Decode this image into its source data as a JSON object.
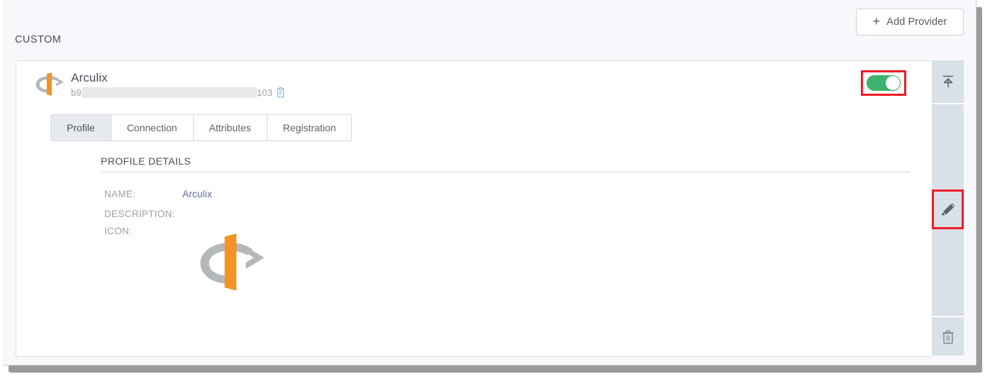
{
  "toolbar": {
    "add_provider_label": "Add Provider",
    "plus_glyph": "+"
  },
  "section": {
    "group_label": "CUSTOM"
  },
  "provider": {
    "name": "Arculix",
    "id_prefix": "b9",
    "id_suffix": "103",
    "id_redacted": true,
    "enabled": true,
    "logo_icon": "arculix-logo-icon",
    "copy_icon": "copy-clipboard-icon"
  },
  "tabs": [
    {
      "label": "Profile",
      "active": true
    },
    {
      "label": "Connection",
      "active": false
    },
    {
      "label": "Attributes",
      "active": false
    },
    {
      "label": "Registration",
      "active": false
    }
  ],
  "profile": {
    "section_title": "PROFILE DETAILS",
    "fields": [
      {
        "label": "NAME:",
        "value": "Arculix"
      },
      {
        "label": "DESCRIPTION:",
        "value": ""
      },
      {
        "label": "ICON:",
        "value": ""
      }
    ]
  },
  "actions": {
    "upload_icon": "upload-icon",
    "edit_icon": "pencil-edit-icon",
    "delete_icon": "trash-delete-icon"
  },
  "colors": {
    "page_bg": "#f8f8fc",
    "card_bg": "#ffffff",
    "toggle_on": "#3eb370",
    "highlight_box": "#ee1c24",
    "rail_bg": "#d8e0e8",
    "accent_orange": "#f39325",
    "logo_gray": "#b5b8bb",
    "link_text": "#5b6c8f"
  }
}
